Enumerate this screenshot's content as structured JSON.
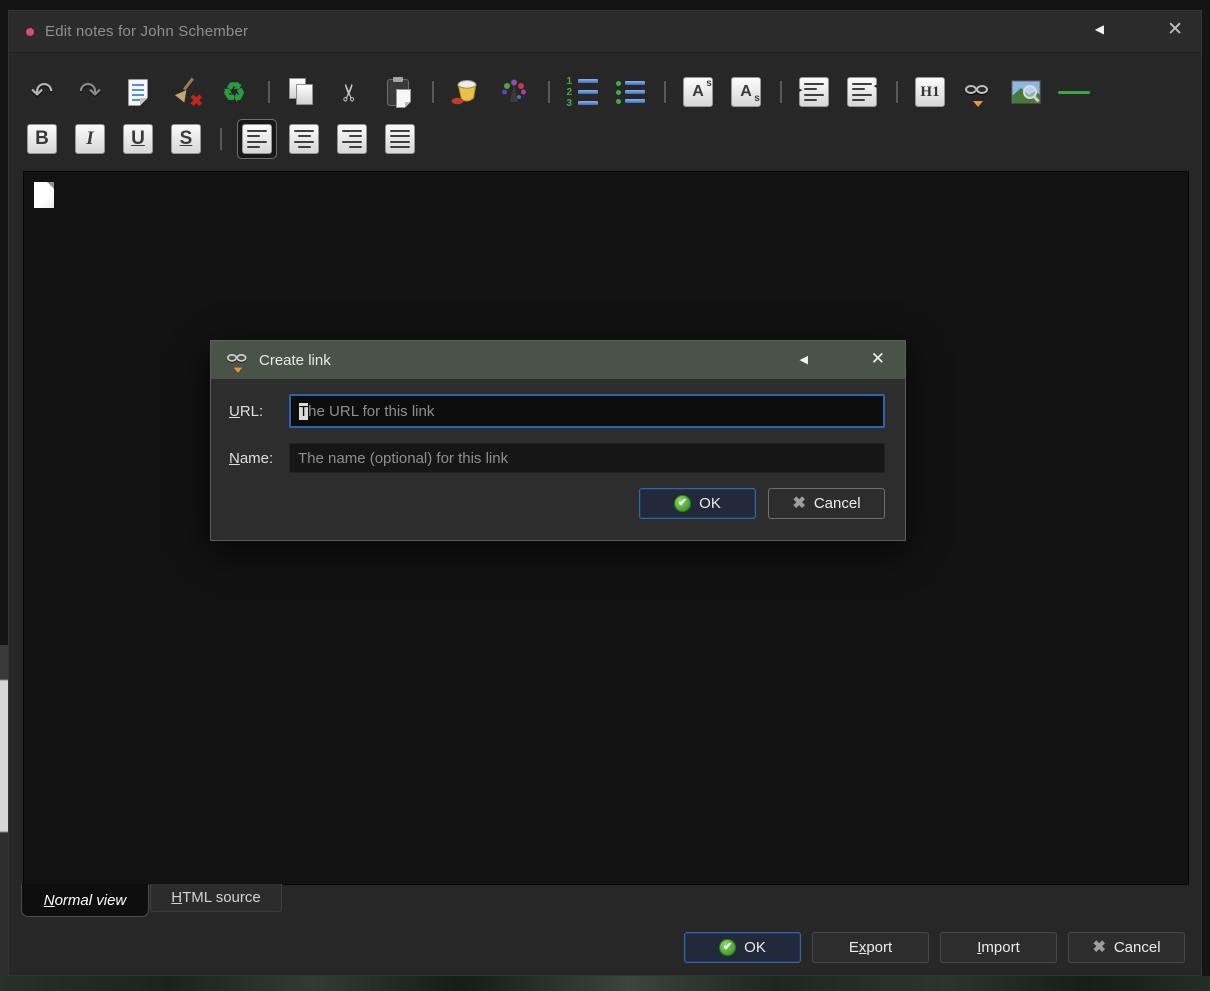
{
  "titlebar": {
    "title": "Edit notes for John Schember"
  },
  "window_controls": {
    "back_glyph": "◀",
    "close_glyph": "✕"
  },
  "glyphs": {
    "check": "✔",
    "cross": "✖",
    "tri_up": "▲",
    "tri_dn": "▼",
    "arr_r": "▸",
    "arr_l": "◂"
  },
  "toolbar": {
    "undo_glyph": "↶",
    "redo_glyph": "↷",
    "cut_glyph": "✂",
    "recycle_glyph": "♻",
    "ol_numbers": [
      "1",
      "2",
      "3"
    ],
    "sup": {
      "base": "A",
      "mark": "s"
    },
    "sub": {
      "base": "A",
      "mark": "s"
    },
    "h1_label": "H1",
    "bold": "B",
    "italic": "I",
    "underline": "U",
    "strike": "S"
  },
  "dialog": {
    "title": "Create link",
    "back_glyph": "◀",
    "close_glyph": "✕",
    "url_field": {
      "accel": "U",
      "rest": "RL:",
      "placeholder": "The URL for this link"
    },
    "name_field": {
      "accel": "N",
      "rest": "ame:",
      "placeholder": "The name (optional) for this link"
    },
    "ok_label": "OK",
    "cancel_label": "Cancel"
  },
  "tabs": {
    "normal": {
      "accel": "N",
      "rest": "ormal view"
    },
    "html": {
      "accel": "H",
      "rest": "TML source"
    }
  },
  "footer": {
    "ok_label": "OK",
    "export": {
      "pre": "E",
      "accel": "x",
      "post": "port"
    },
    "import": {
      "pre": "",
      "accel": "I",
      "post": "mport"
    },
    "cancel_label": "Cancel"
  },
  "colors": {
    "title_dot": "#d9487e",
    "dialog_titlebar": "#4a5348",
    "accent_blue": "#2e62ad",
    "ok_green": "#3f9e2b",
    "hr_green": "#3aa54a"
  }
}
